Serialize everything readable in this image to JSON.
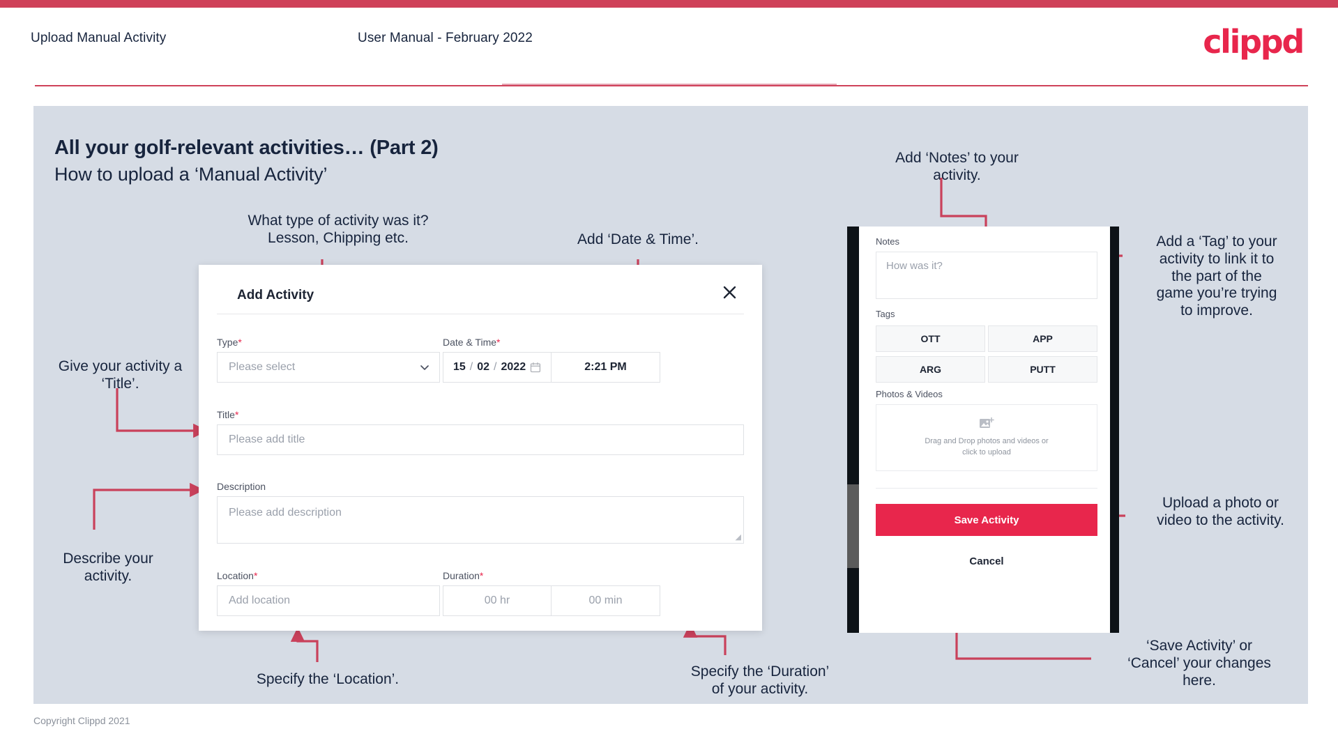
{
  "header": {
    "left_title": "Upload Manual Activity",
    "center_title": "User Manual - February 2022",
    "logo": "clippd"
  },
  "slide": {
    "title_bold": "All your golf-relevant activities… (Part 2)",
    "title_sub": "How to upload a ‘Manual Activity’"
  },
  "annotations": {
    "type": "What type of activity was it?\nLesson, Chipping etc.",
    "datetime": "Add ‘Date & Time’.",
    "notes": "Add ‘Notes’ to your\nactivity.",
    "tag": "Add a ‘Tag’ to your\nactivity to link it to\nthe part of the\ngame you’re trying\nto improve.",
    "title": "Give your activity a\n‘Title’.",
    "describe": "Describe your\nactivity.",
    "location": "Specify the ‘Location’.",
    "duration": "Specify the ‘Duration’\nof your activity.",
    "upload": "Upload a photo or\nvideo to the activity.",
    "save_cancel": "‘Save Activity’ or\n‘Cancel’ your changes\nhere."
  },
  "modal": {
    "title": "Add Activity",
    "close_icon": "close-icon",
    "fields": {
      "type_label": "Type",
      "type_placeholder": "Please select",
      "datetime_label": "Date & Time",
      "date_day": "15",
      "date_month": "02",
      "date_year": "2022",
      "date_sep": "/",
      "time_value": "2:21 PM",
      "title_label": "Title",
      "title_placeholder": "Please add title",
      "description_label": "Description",
      "description_placeholder": "Please add description",
      "location_label": "Location",
      "location_placeholder": "Add location",
      "duration_label": "Duration",
      "duration_hours": "00 hr",
      "duration_minutes": "00 min",
      "required_mark": "*"
    }
  },
  "phone": {
    "notes_label": "Notes",
    "notes_placeholder": "How was it?",
    "tags_label": "Tags",
    "tags": [
      "OTT",
      "APP",
      "ARG",
      "PUTT"
    ],
    "photos_label": "Photos & Videos",
    "upload_text": "Drag and Drop photos and videos or\nclick to upload",
    "save_label": "Save Activity",
    "cancel_label": "Cancel"
  },
  "footer": {
    "copyright": "Copyright Clippd 2021"
  },
  "colors": {
    "brand_red": "#e8264c",
    "bar_red": "#cf4159",
    "slide_bg": "#d6dce5",
    "text_dark": "#17243d",
    "arrow": "#c9415b"
  }
}
